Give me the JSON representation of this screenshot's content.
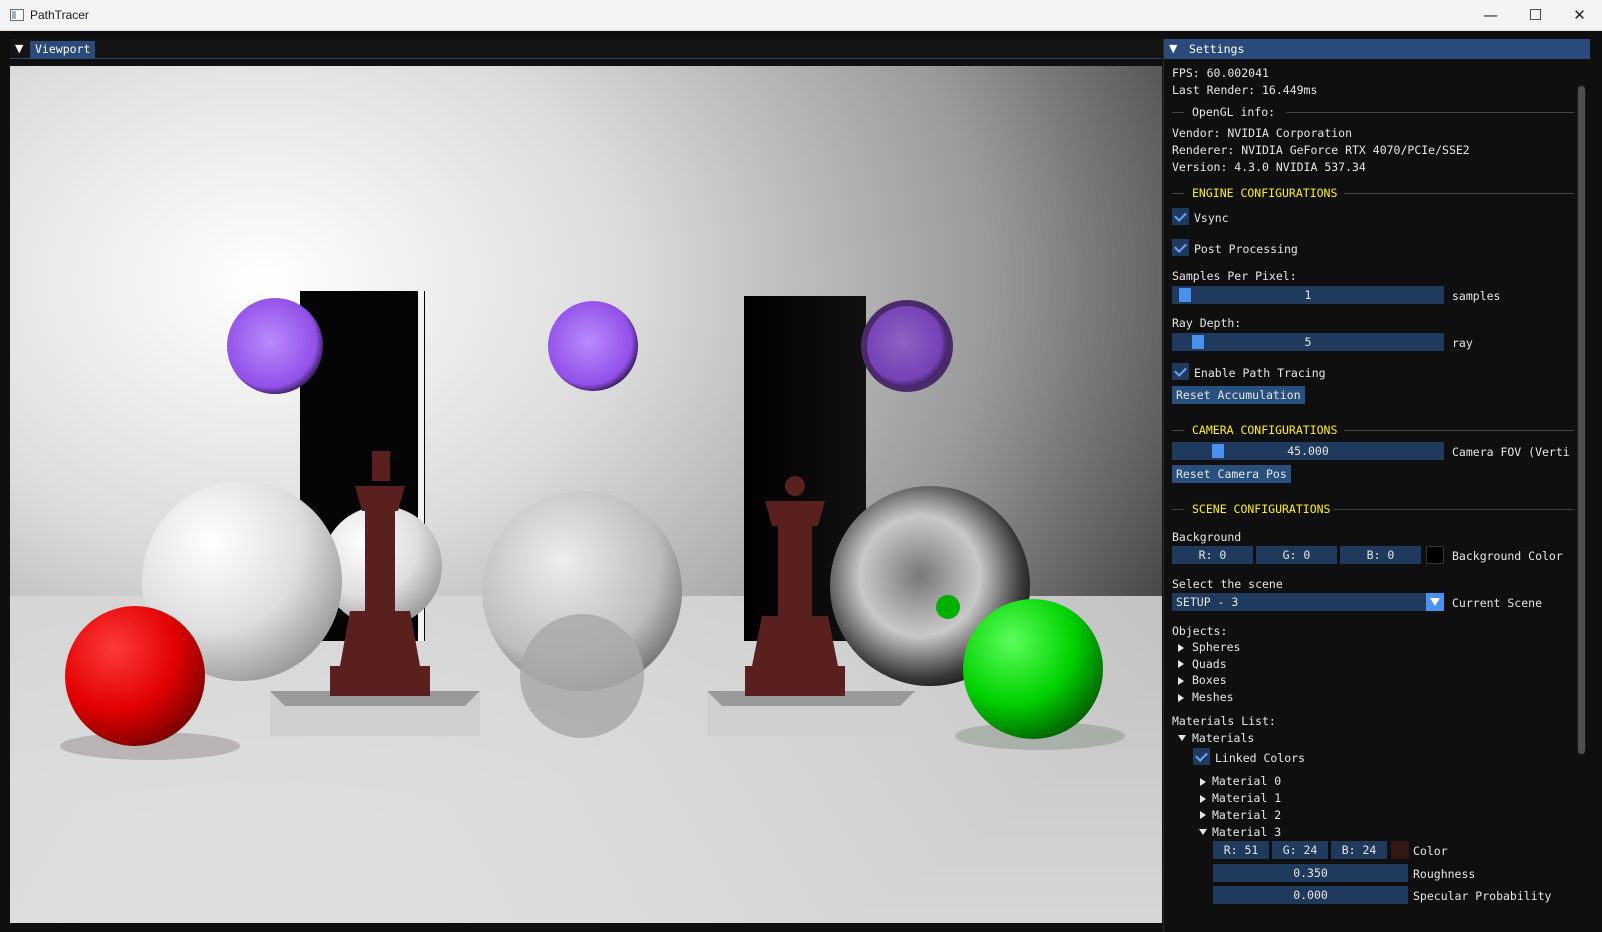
{
  "window": {
    "title": "PathTracer",
    "minimize_glyph": "—",
    "maximize_glyph": "☐",
    "close_glyph": "✕"
  },
  "viewport": {
    "tab_label": "Viewport",
    "collapse_glyph": "▼"
  },
  "settings": {
    "tab_label": "Settings",
    "collapse_glyph": "▼",
    "fps": "FPS: 60.002041",
    "last_render": "Last Render: 16.449ms",
    "opengl_header": "OpenGL info:",
    "vendor": "Vendor: NVIDIA Corporation",
    "renderer": "Renderer: NVIDIA GeForce RTX 4070/PCIe/SSE2",
    "version": "Version: 4.3.0 NVIDIA 537.34",
    "engine_header": "ENGINE CONFIGURATIONS",
    "vsync_label": "Vsync",
    "vsync_checked": true,
    "post_processing_label": "Post Processing",
    "post_processing_checked": true,
    "spp_label": "Samples Per Pixel:",
    "spp_value": "1",
    "spp_level": 0.02,
    "spp_unit": "samples",
    "ray_depth_label": "Ray Depth:",
    "ray_depth_value": "5",
    "ray_depth_level": 0.07,
    "ray_depth_unit": "ray",
    "path_tracing_label": "Enable Path Tracing",
    "path_tracing_checked": true,
    "reset_accum_label": "Reset Accumulation",
    "camera_header": "CAMERA CONFIGURATIONS",
    "fov_value": "45.000",
    "fov_level": 0.15,
    "fov_label": "Camera FOV (Verti",
    "reset_camera_label": "Reset Camera Pos",
    "scene_header": "SCENE CONFIGURATIONS",
    "background_label": "Background",
    "bg_r": "R:  0",
    "bg_g": "G:  0",
    "bg_b": "B:  0",
    "bg_color": "#000000",
    "bg_color_label": "Background Color",
    "select_scene_label": "Select the scene",
    "scene_value": "SETUP - 3",
    "current_scene_label": "Current Scene",
    "objects_label": "Objects:",
    "objects": [
      "Spheres",
      "Quads",
      "Boxes",
      "Meshes"
    ],
    "materials_list_label": "Materials List:",
    "materials_node": "Materials",
    "linked_colors_label": "Linked Colors",
    "linked_colors_checked": true,
    "materials": [
      "Material 0",
      "Material 1",
      "Material 2",
      "Material 3"
    ],
    "mat3_r": "R: 51",
    "mat3_g": "G: 24",
    "mat3_b": "B: 24",
    "mat3_color": "#331818",
    "mat3_color_label": "Color",
    "roughness_value": "0.350",
    "roughness_label": "Roughness",
    "specular_value": "0.000",
    "specular_label": "Specular Probability"
  },
  "colors": {
    "accent": "#294a7a",
    "frame_bg": "#1f3a5c",
    "slider_grab": "#4a90f0",
    "section_header": "#ffef1a",
    "panel_bg": "#0f0f0f"
  }
}
